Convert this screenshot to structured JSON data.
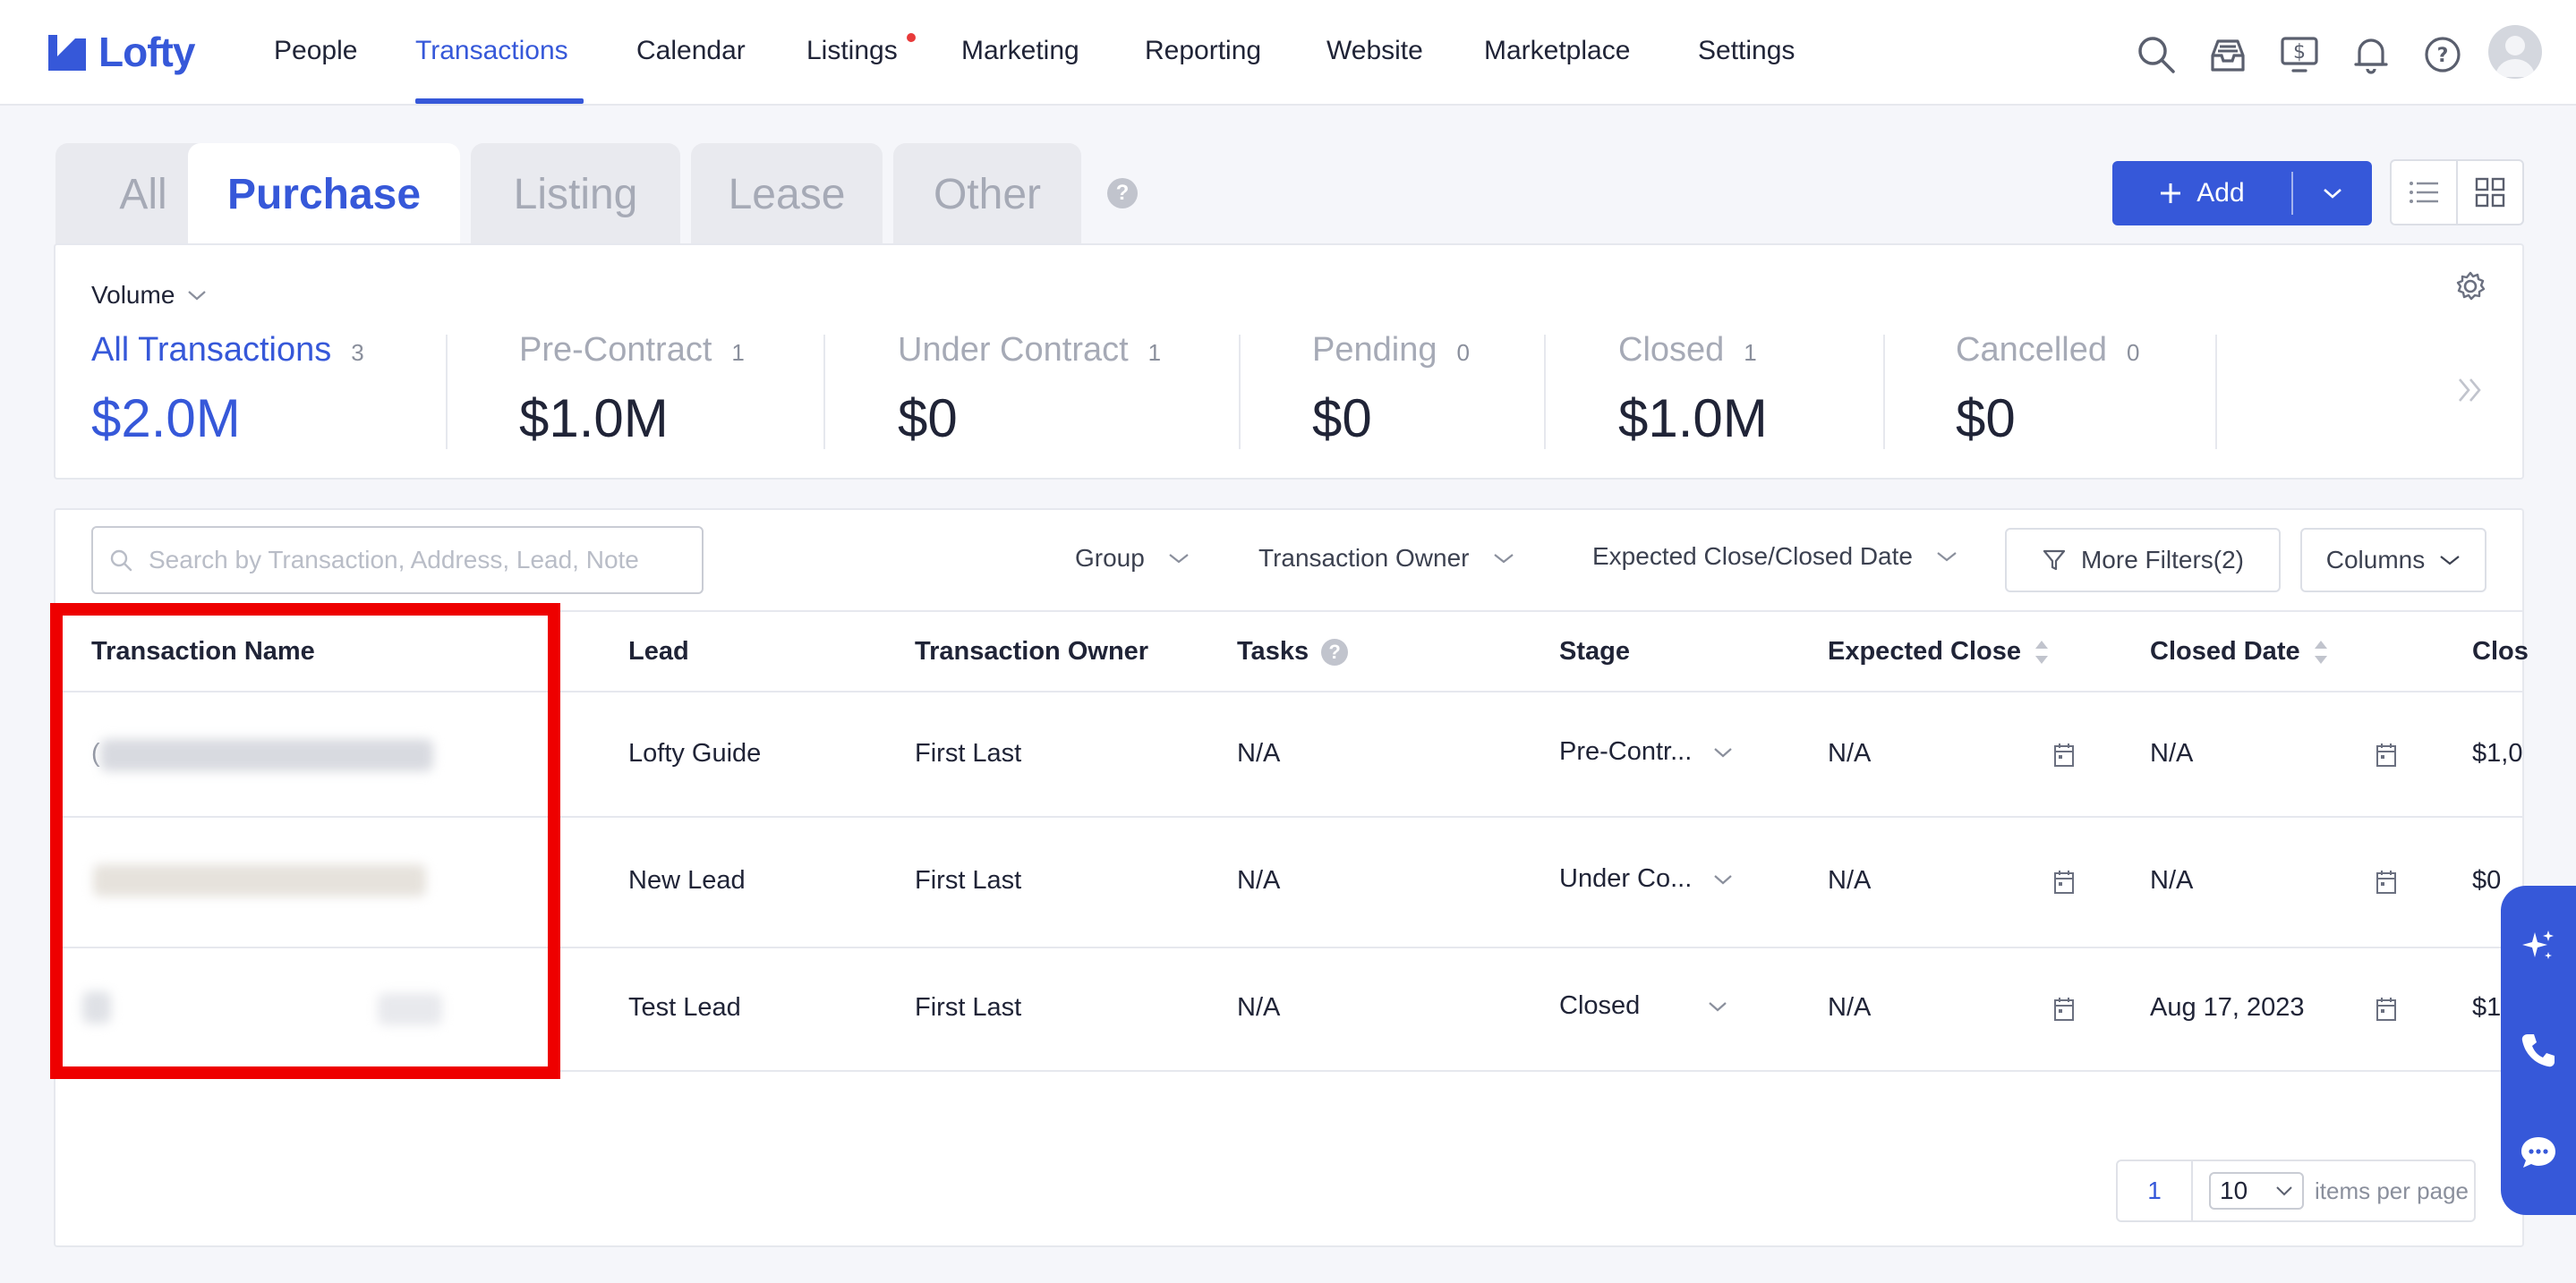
{
  "app": {
    "name": "Lofty"
  },
  "nav": {
    "items": [
      {
        "label": "People"
      },
      {
        "label": "Transactions"
      },
      {
        "label": "Calendar"
      },
      {
        "label": "Listings"
      },
      {
        "label": "Marketing"
      },
      {
        "label": "Reporting"
      },
      {
        "label": "Website"
      },
      {
        "label": "Marketplace"
      },
      {
        "label": "Settings"
      }
    ],
    "active": "Transactions"
  },
  "tabs": {
    "items": [
      {
        "label": "All"
      },
      {
        "label": "Purchase"
      },
      {
        "label": "Listing"
      },
      {
        "label": "Lease"
      },
      {
        "label": "Other"
      }
    ],
    "active": "Purchase",
    "help": "?"
  },
  "actions": {
    "add_label": "Add"
  },
  "summary": {
    "volume_label": "Volume",
    "stats": [
      {
        "label": "All Transactions",
        "count": "3",
        "value": "$2.0M"
      },
      {
        "label": "Pre-Contract",
        "count": "1",
        "value": "$1.0M"
      },
      {
        "label": "Under Contract",
        "count": "1",
        "value": "$0"
      },
      {
        "label": "Pending",
        "count": "0",
        "value": "$0"
      },
      {
        "label": "Closed",
        "count": "1",
        "value": "$1.0M"
      },
      {
        "label": "Cancelled",
        "count": "0",
        "value": "$0"
      }
    ]
  },
  "toolbar": {
    "search_placeholder": "Search by Transaction, Address, Lead, Note",
    "group": "Group",
    "owner": "Transaction Owner",
    "date": "Expected Close/Closed Date",
    "more_filters": "More Filters(2)",
    "columns": "Columns"
  },
  "table": {
    "headers": {
      "name": "Transaction Name",
      "lead": "Lead",
      "owner": "Transaction Owner",
      "tasks": "Tasks",
      "stage": "Stage",
      "expected": "Expected Close",
      "closed_date": "Closed Date",
      "closing": "Clos"
    },
    "rows": [
      {
        "name_initial": "(",
        "lead": "Lofty Guide",
        "owner": "First Last",
        "tasks": "N/A",
        "stage": "Pre-Contr...",
        "expected": "N/A",
        "closed_date": "N/A",
        "closing": "$1,0"
      },
      {
        "name_initial": "",
        "lead": "New Lead",
        "owner": "First Last",
        "tasks": "N/A",
        "stage": "Under Co...",
        "expected": "N/A",
        "closed_date": "N/A",
        "closing": "$0"
      },
      {
        "name_initial": "",
        "lead": "Test Lead",
        "owner": "First Last",
        "tasks": "N/A",
        "stage": "Closed",
        "expected": "N/A",
        "closed_date": "Aug 17, 2023",
        "closing": "$1"
      }
    ]
  },
  "pagination": {
    "page": "1",
    "page_size": "10",
    "label": "items per page"
  },
  "colors": {
    "accent": "#3658d9",
    "highlight": "#ee0000",
    "notification": "#e83a3a"
  }
}
